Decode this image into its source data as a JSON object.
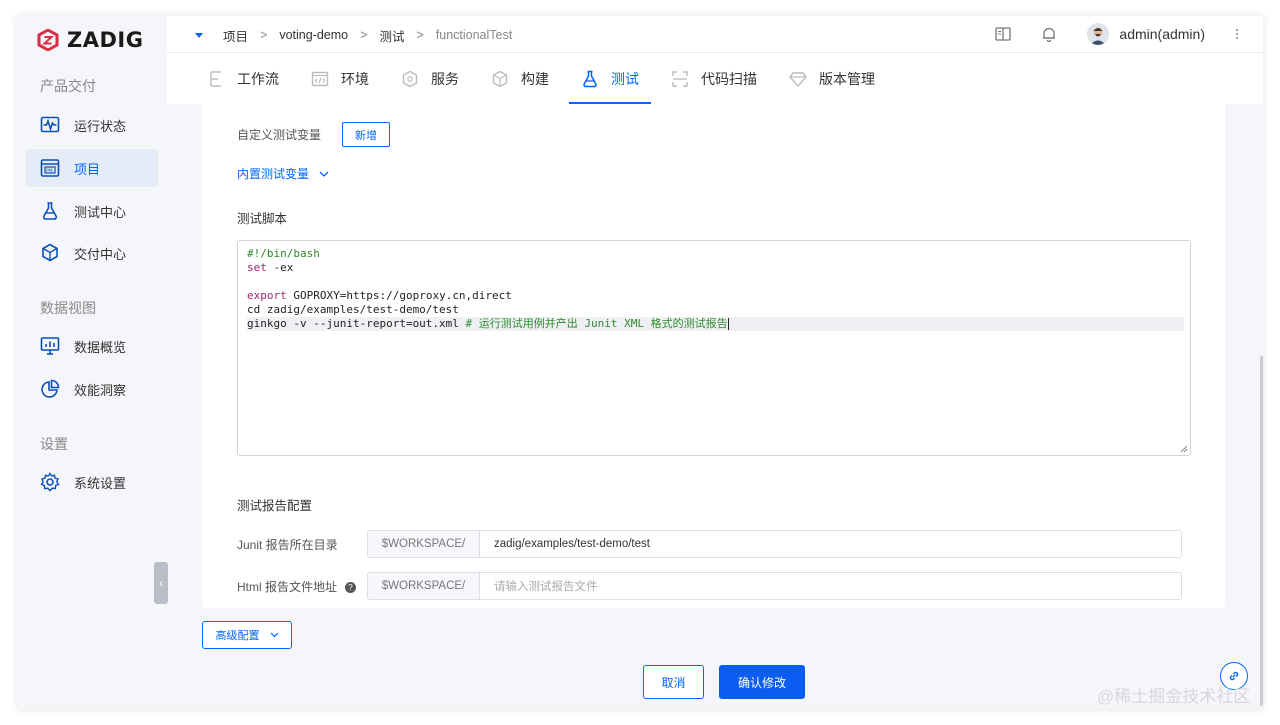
{
  "app": {
    "logo_text": "ZADIG",
    "accent_color": "#0066ff",
    "logo_color": "#e02b45"
  },
  "sidebar": {
    "groups": [
      {
        "title": "产品交付",
        "items": [
          {
            "label": "运行状态",
            "icon": "pulse-monitor-icon"
          },
          {
            "label": "项目",
            "icon": "pm-board-icon",
            "active": true
          },
          {
            "label": "测试中心",
            "icon": "flask-icon"
          },
          {
            "label": "交付中心",
            "icon": "package-icon"
          }
        ]
      },
      {
        "title": "数据视图",
        "items": [
          {
            "label": "数据概览",
            "icon": "monitor-chart-icon"
          },
          {
            "label": "效能洞察",
            "icon": "pie-chart-icon"
          }
        ]
      },
      {
        "title": "设置",
        "items": [
          {
            "label": "系统设置",
            "icon": "gear-icon"
          }
        ]
      }
    ],
    "collapse_glyph": "‹"
  },
  "topbar": {
    "breadcrumb": [
      "项目",
      "voting-demo",
      "测试",
      "functionalTest"
    ],
    "breadcrumb_sep": ">",
    "user": "admin(admin)",
    "tabs": [
      {
        "label": "工作流",
        "icon": "workflow-icon"
      },
      {
        "label": "环境",
        "icon": "environment-icon"
      },
      {
        "label": "服务",
        "icon": "service-icon"
      },
      {
        "label": "构建",
        "icon": "build-cube-icon"
      },
      {
        "label": "测试",
        "icon": "flask-icon",
        "active": true
      },
      {
        "label": "代码扫描",
        "icon": "scan-icon"
      },
      {
        "label": "版本管理",
        "icon": "version-diamond-icon"
      }
    ]
  },
  "form": {
    "custom_vars_label": "自定义测试变量",
    "add_button": "新增",
    "builtin_vars_link": "内置测试变量",
    "script_title": "测试脚本",
    "script_lines": [
      {
        "segments": [
          {
            "t": "#!/bin/bash",
            "c": "comment"
          }
        ]
      },
      {
        "segments": [
          {
            "t": "set",
            "c": "kw"
          },
          {
            "t": " -ex",
            "c": "dark"
          }
        ]
      },
      {
        "segments": []
      },
      {
        "segments": [
          {
            "t": "export",
            "c": "kw"
          },
          {
            "t": " GOPROXY=https://goproxy.cn,direct",
            "c": "dark"
          }
        ]
      },
      {
        "segments": [
          {
            "t": "cd zadig/examples/test-demo/test",
            "c": "dark"
          }
        ]
      },
      {
        "segments": [
          {
            "t": "ginkgo -v --junit-report=out.xml ",
            "c": "dark"
          },
          {
            "t": "# 运行测试用例并产出 Junit XML 格式的测试报告",
            "c": "comment"
          }
        ],
        "highlight": true,
        "cursor": true
      }
    ],
    "report_title": "测试报告配置",
    "junit_label": "Junit 报告所在目录",
    "junit_prefix": "$WORKSPACE/",
    "junit_value": "zadig/examples/test-demo/test",
    "html_label": "Html 报告文件地址",
    "html_prefix": "$WORKSPACE/",
    "html_placeholder": "请输入测试报告文件",
    "help_glyph": "?"
  },
  "footer": {
    "advanced_button": "高级配置",
    "cancel_button": "取消",
    "confirm_button": "确认修改"
  },
  "watermark": "@稀土掘金技术社区"
}
